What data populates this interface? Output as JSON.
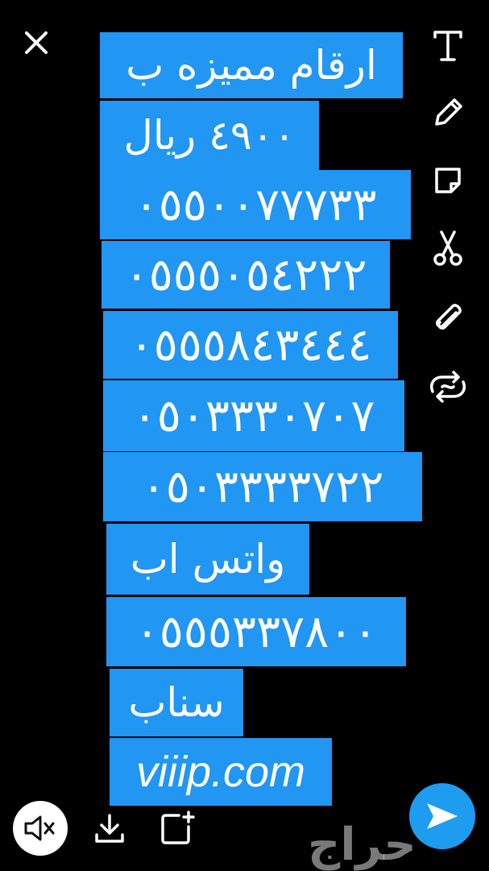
{
  "labels": [
    {
      "text": "ارقام مميزه ب"
    },
    {
      "text": "٤٩٠٠ ريال"
    },
    {
      "text": "٠٥٥٠٠٧٧٧٣٣"
    },
    {
      "text": "٠٥٥٥٠٥٤٢٢٢"
    },
    {
      "text": "٠٥٥٥٨٤٣٤٤٤"
    },
    {
      "text": "٠٥٠٣٣٣٠٧٠٧"
    },
    {
      "text": "٠٥٠٣٣٣٣٧٢٢"
    },
    {
      "text": "واتس اب"
    },
    {
      "text": "٠٥٥٥٣٣٧٨٠٠"
    },
    {
      "text": "سناب"
    },
    {
      "text": "viiip.com"
    }
  ],
  "toolbar": {
    "icons": [
      "text-icon",
      "pencil-icon",
      "sticker-icon",
      "scissors-icon",
      "paperclip-icon",
      "loop-icon"
    ]
  },
  "bottom_bar": {
    "icons": [
      "mute-icon",
      "download-icon",
      "add-story-icon",
      "send-icon"
    ]
  },
  "watermark": {
    "text": "حراج"
  },
  "colors": {
    "label_bg": "#2196f3",
    "background": "#000000",
    "send_button": "#1e9cf0"
  }
}
